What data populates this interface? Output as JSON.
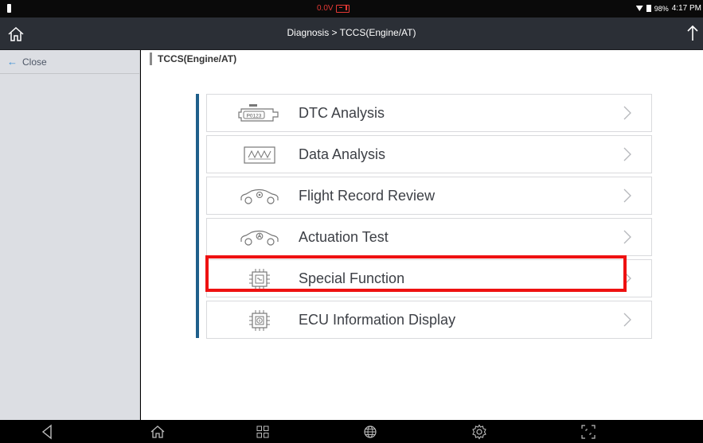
{
  "status_bar": {
    "voltage": "0.0V",
    "battery_percent": "98%",
    "time": "4:17 PM"
  },
  "header": {
    "title": "Diagnosis > TCCS(Engine/AT)"
  },
  "sidebar": {
    "close_label": "Close",
    "close_arrow": "←"
  },
  "main": {
    "section_title": "TCCS(Engine/AT)",
    "menu_items": [
      {
        "label": "DTC Analysis",
        "icon": "dtc-code-icon",
        "icon_text": "P0123"
      },
      {
        "label": "Data Analysis",
        "icon": "waveform-icon"
      },
      {
        "label": "Flight Record Review",
        "icon": "car-record-icon"
      },
      {
        "label": "Actuation Test",
        "icon": "car-actuation-icon"
      },
      {
        "label": "Special Function",
        "icon": "chip-function-icon"
      },
      {
        "label": "ECU Information Display",
        "icon": "chip-info-icon"
      }
    ],
    "highlighted_item": "Special Function"
  },
  "colors": {
    "accent": "#1f5f8b",
    "highlight": "#ee1111",
    "voltage_warning": "#e53935"
  },
  "nav_bar": {
    "buttons": [
      "back-icon",
      "home-icon",
      "recent-apps-icon",
      "browser-icon",
      "settings-icon",
      "screenshot-icon"
    ]
  }
}
